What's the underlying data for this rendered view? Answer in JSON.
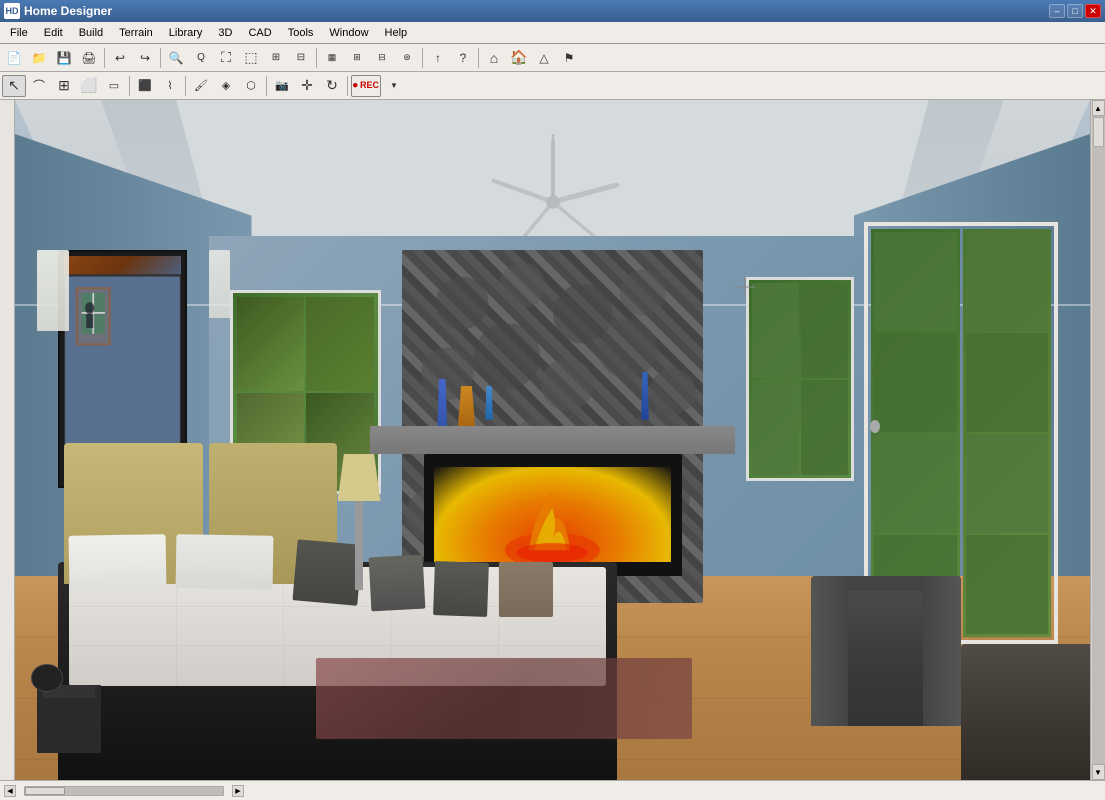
{
  "app": {
    "title": "Home Designer",
    "icon": "HD"
  },
  "titlebar": {
    "title": "Home Designer",
    "min_label": "–",
    "max_label": "□",
    "close_label": "✕"
  },
  "menubar": {
    "items": [
      {
        "id": "file",
        "label": "File"
      },
      {
        "id": "edit",
        "label": "Edit"
      },
      {
        "id": "build",
        "label": "Build"
      },
      {
        "id": "terrain",
        "label": "Terrain"
      },
      {
        "id": "library",
        "label": "Library"
      },
      {
        "id": "3d",
        "label": "3D"
      },
      {
        "id": "cad",
        "label": "CAD"
      },
      {
        "id": "tools",
        "label": "Tools"
      },
      {
        "id": "window",
        "label": "Window"
      },
      {
        "id": "help",
        "label": "Help"
      }
    ]
  },
  "toolbar1": {
    "buttons": [
      {
        "id": "new",
        "icon": "📄",
        "tooltip": "New"
      },
      {
        "id": "open",
        "icon": "📁",
        "tooltip": "Open"
      },
      {
        "id": "save",
        "icon": "💾",
        "tooltip": "Save"
      },
      {
        "id": "print",
        "icon": "🖨",
        "tooltip": "Print"
      },
      {
        "id": "undo",
        "icon": "↩",
        "tooltip": "Undo"
      },
      {
        "id": "redo",
        "icon": "↪",
        "tooltip": "Redo"
      },
      {
        "id": "zoom-in",
        "icon": "🔍",
        "tooltip": "Zoom In"
      },
      {
        "id": "zoom-out",
        "icon": "🔎",
        "tooltip": "Zoom Out"
      },
      {
        "id": "fit",
        "icon": "⛶",
        "tooltip": "Fit"
      },
      {
        "id": "zoom-rect",
        "icon": "⬚",
        "tooltip": "Zoom Rectangle"
      }
    ]
  },
  "toolbar2": {
    "buttons": [
      {
        "id": "select",
        "icon": "↖",
        "tooltip": "Select"
      },
      {
        "id": "line",
        "icon": "╱",
        "tooltip": "Draw Line"
      },
      {
        "id": "wall",
        "icon": "⊟",
        "tooltip": "Draw Wall"
      },
      {
        "id": "room",
        "icon": "⬜",
        "tooltip": "Draw Room"
      },
      {
        "id": "door",
        "icon": "🚪",
        "tooltip": "Door"
      },
      {
        "id": "window",
        "icon": "⬛",
        "tooltip": "Window"
      },
      {
        "id": "stair",
        "icon": "⌇",
        "tooltip": "Stair"
      },
      {
        "id": "roof",
        "icon": "⌂",
        "tooltip": "Roof"
      },
      {
        "id": "paint",
        "icon": "🎨",
        "tooltip": "Paint"
      },
      {
        "id": "material",
        "icon": "◈",
        "tooltip": "Material"
      },
      {
        "id": "texture",
        "icon": "⬡",
        "tooltip": "Texture"
      },
      {
        "id": "move",
        "icon": "✛",
        "tooltip": "Move"
      },
      {
        "id": "rotate",
        "icon": "↻",
        "tooltip": "Rotate"
      },
      {
        "id": "rec",
        "icon": "⬤",
        "tooltip": "Record",
        "label": "REC"
      }
    ]
  },
  "statusbar": {
    "scroll_left": "◀",
    "scroll_right": "▶"
  },
  "scene": {
    "description": "3D bedroom interior view with fireplace, bed, and windows"
  }
}
